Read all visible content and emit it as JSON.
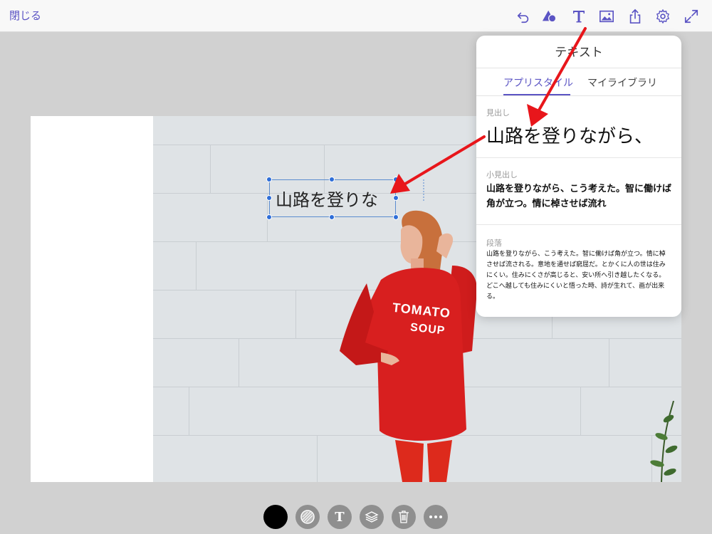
{
  "topbar": {
    "close_label": "閉じる",
    "icons": [
      "undo-icon",
      "shapes-icon",
      "text-icon",
      "image-icon",
      "share-icon",
      "settings-icon",
      "fullscreen-icon"
    ],
    "accent_color": "#5b54c4"
  },
  "canvas": {
    "selected_text": "山路を登りな",
    "photo_shirt_line1": "TOMATO",
    "photo_shirt_line2": "SOUP"
  },
  "popover": {
    "title": "テキスト",
    "tabs": [
      {
        "label": "アプリスタイル",
        "active": true
      },
      {
        "label": "マイライブラリ",
        "active": false
      }
    ],
    "styles": [
      {
        "label": "見出し",
        "sample": "山路を登りながら、"
      },
      {
        "label": "小見出し",
        "sample": "山路を登りながら、こう考えた。智に働けば角が立つ。情に棹させば流れ"
      },
      {
        "label": "段落",
        "sample": "山路を登りながら、こう考えた。智に働けば角が立つ。情に棹させば流される。意地を通せば窮屈だ。とかくに人の世は住みにくい。住みにくさが高じると、安い所へ引き越したくなる。どこへ越しても住みにくいと悟った時、詩が生れて、画が出来る。"
      }
    ]
  },
  "bottombar": {
    "text_button_glyph": "T",
    "icons": [
      "color-swatch-icon",
      "fill-pattern-icon",
      "text-style-icon",
      "layers-icon",
      "trash-icon",
      "more-icon"
    ]
  },
  "annotation_color": "#e8161b"
}
